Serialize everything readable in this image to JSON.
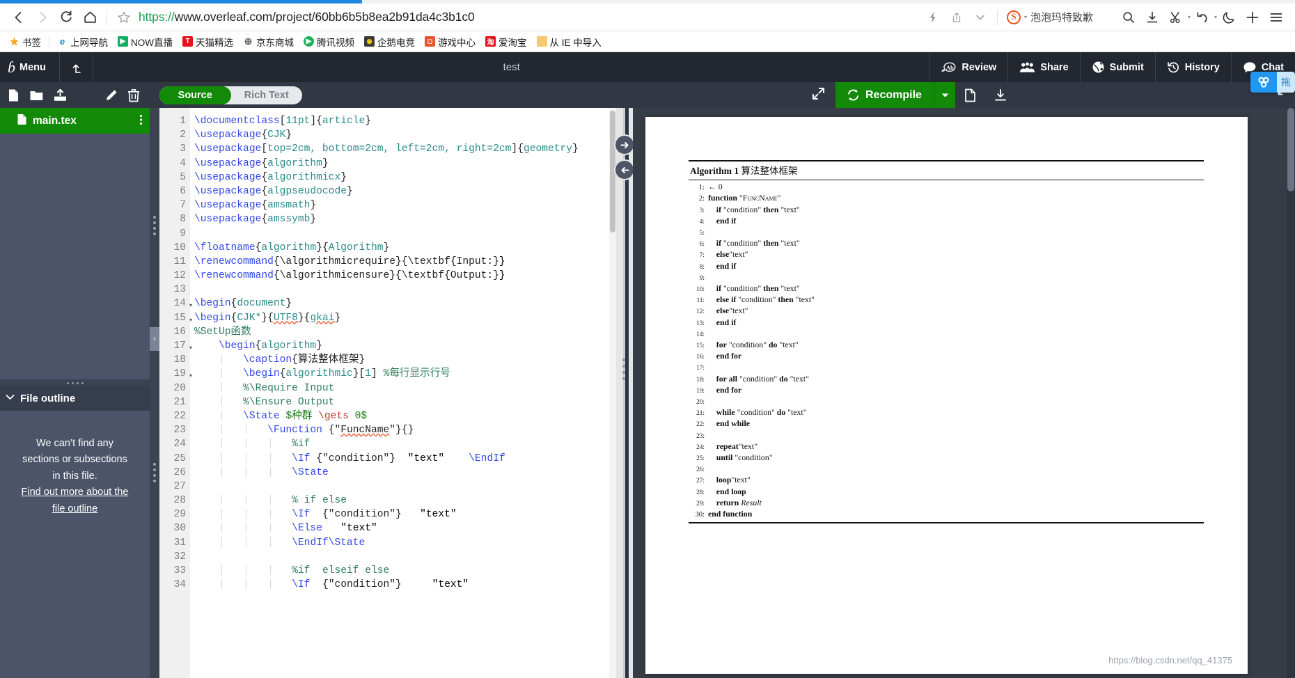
{
  "browser": {
    "url_scheme": "https://",
    "url_rest": "www.overleaf.com/project/60bb6b5b8ea2b91da4c3b1c0",
    "back_icon": "back-arrow-icon",
    "forward_icon": "forward-arrow-icon",
    "reload_icon": "reload-icon",
    "home_icon": "home-icon",
    "star_icon": "star-outline-icon",
    "lightning_icon": "lightning-icon",
    "share_icon": "share-icon",
    "chevron_icon": "chevron-down-icon",
    "profile_badge": "S",
    "profile_name": "泡泡玛特致歉",
    "search_icon": "search-icon",
    "download_icon": "download-icon",
    "scissors_icon": "scissors-icon",
    "undo_icon": "undo-icon",
    "moon_icon": "moon-icon",
    "plus_icon": "plus-icon",
    "menu_icon": "hamburger-menu-icon",
    "bookmarks": [
      {
        "label": "书签",
        "color": "#ffffff",
        "glyph": "★",
        "fg": "#f5a623"
      },
      {
        "label": "上网导航",
        "color": "#1a8cd8",
        "glyph": "e",
        "fg": "#ffffff"
      },
      {
        "label": "NOW直播",
        "color": "#0fae63",
        "glyph": "▶",
        "fg": "#ffffff"
      },
      {
        "label": "天猫精选",
        "color": "#e8131a",
        "glyph": "T",
        "fg": "#ffffff"
      },
      {
        "label": "京东商城",
        "color": "#ffffff",
        "glyph": "⊕",
        "fg": "#555555"
      },
      {
        "label": "腾讯视频",
        "color": "#1ab35a",
        "glyph": "▶",
        "fg": "#ffffff"
      },
      {
        "label": "企鹅电竞",
        "color": "#3b3b3b",
        "glyph": "🐧",
        "fg": "#ffd400"
      },
      {
        "label": "游戏中心",
        "color": "#e8542f",
        "glyph": "🎮",
        "fg": "#ffffff"
      },
      {
        "label": "爱淘宝",
        "color": "#e8131a",
        "glyph": "淘",
        "fg": "#ffffff"
      },
      {
        "label": "从 IE 中导入",
        "color": "#f7c873",
        "glyph": "",
        "fg": "#8a6d20"
      }
    ]
  },
  "overleaf_header": {
    "logo_glyph": "ɓ",
    "menu_label": "Menu",
    "back_icon": "up-left-arrow-icon",
    "project_title": "test",
    "buttons": [
      {
        "label": "Review",
        "icon": "review-ab-icon"
      },
      {
        "label": "Share",
        "icon": "people-icon"
      },
      {
        "label": "Submit",
        "icon": "globe-icon"
      },
      {
        "label": "History",
        "icon": "history-clock-icon"
      },
      {
        "label": "Chat",
        "icon": "chat-bubble-icon"
      }
    ],
    "floating_widget": {
      "icon": "sogou-logo-icon",
      "label": "拖"
    }
  },
  "editor_toolbar": {
    "new_file_icon": "new-file-icon",
    "new_folder_icon": "new-folder-icon",
    "upload_icon": "upload-icon",
    "rename_icon": "pencil-icon",
    "delete_icon": "trash-icon",
    "mode_source": "Source",
    "mode_rich_text": "Rich Text",
    "expand_icon": "expand-diagonal-icon",
    "recompile_label": "Recompile",
    "recompile_icon": "refresh-icon",
    "recompile_caret": "caret-down-icon",
    "pdf_icon": "pdf-file-icon",
    "download_pdf_icon": "download-pdf-icon",
    "fullscreen_icon": "fullscreen-corner-icon"
  },
  "sidebar": {
    "files": [
      {
        "name": "main.tex",
        "icon": "tex-file-icon",
        "menu": "kebab-menu-icon",
        "selected": true
      }
    ],
    "outline": {
      "chevron": "chevron-down-icon",
      "title": "File outline",
      "empty_line1": "We can’t find any",
      "empty_line2": "sections or subsections",
      "empty_line3": "in this file.",
      "link_line1": "Find out more about the",
      "link_line2": "file outline"
    }
  },
  "code": {
    "first_visible_line": 1,
    "lines": [
      {
        "n": 1,
        "fold": false,
        "text": "\\documentclass[11pt]{article}"
      },
      {
        "n": 2,
        "fold": false,
        "text": "\\usepackage{CJK}"
      },
      {
        "n": 3,
        "fold": false,
        "text": "\\usepackage[top=2cm, bottom=2cm, left=2cm, right=2cm]{geometry}"
      },
      {
        "n": 4,
        "fold": false,
        "text": "\\usepackage{algorithm}"
      },
      {
        "n": 5,
        "fold": false,
        "text": "\\usepackage{algorithmicx}"
      },
      {
        "n": 6,
        "fold": false,
        "text": "\\usepackage{algpseudocode}"
      },
      {
        "n": 7,
        "fold": false,
        "text": "\\usepackage{amsmath}"
      },
      {
        "n": 8,
        "fold": false,
        "text": "\\usepackage{amssymb}"
      },
      {
        "n": 9,
        "fold": false,
        "text": ""
      },
      {
        "n": 10,
        "fold": false,
        "text": "\\floatname{algorithm}{Algorithm}"
      },
      {
        "n": 11,
        "fold": false,
        "text": "\\renewcommand{\\algorithmicrequire}{\\textbf{Input:}}"
      },
      {
        "n": 12,
        "fold": false,
        "text": "\\renewcommand{\\algorithmicensure}{\\textbf{Output:}}"
      },
      {
        "n": 13,
        "fold": false,
        "text": ""
      },
      {
        "n": 14,
        "fold": true,
        "text": "\\begin{document}"
      },
      {
        "n": 15,
        "fold": true,
        "text": "\\begin{CJK*}{UTF8}{gkai}"
      },
      {
        "n": 16,
        "fold": false,
        "text": "%SetUp函数"
      },
      {
        "n": 17,
        "fold": true,
        "text": "    \\begin{algorithm}"
      },
      {
        "n": 18,
        "fold": false,
        "text": "        \\caption{算法整体框架}"
      },
      {
        "n": 19,
        "fold": true,
        "text": "        \\begin{algorithmic}[1] %每行显示行号"
      },
      {
        "n": 20,
        "fold": false,
        "text": "        %\\Require Input"
      },
      {
        "n": 21,
        "fold": false,
        "text": "        %\\Ensure Output"
      },
      {
        "n": 22,
        "fold": false,
        "text": "        \\State $种群 \\gets 0$"
      },
      {
        "n": 23,
        "fold": false,
        "text": "            \\Function {\"FuncName\"}{}"
      },
      {
        "n": 24,
        "fold": false,
        "text": "                %if"
      },
      {
        "n": 25,
        "fold": false,
        "text": "                \\If {\"condition\"}  \"text\"    \\EndIf"
      },
      {
        "n": 26,
        "fold": false,
        "text": "                \\State"
      },
      {
        "n": 27,
        "fold": false,
        "text": ""
      },
      {
        "n": 28,
        "fold": false,
        "text": "                % if else"
      },
      {
        "n": 29,
        "fold": false,
        "text": "                \\If  {\"condition\"}   \"text\""
      },
      {
        "n": 30,
        "fold": false,
        "text": "                \\Else   \"text\""
      },
      {
        "n": 31,
        "fold": false,
        "text": "                \\EndIf\\State"
      },
      {
        "n": 32,
        "fold": false,
        "text": ""
      },
      {
        "n": 33,
        "fold": false,
        "text": "                %if  elseif else"
      },
      {
        "n": 34,
        "fold": false,
        "text": "                \\If  {\"condition\"}     \"text\""
      }
    ]
  },
  "pdf": {
    "algorithm_label": "Algorithm 1",
    "algorithm_caption": "算法整体框架",
    "watermark": "https://blog.csdn.net/qq_41375",
    "lines": [
      {
        "n": "1:",
        "indent": 0,
        "html": "← 0"
      },
      {
        "n": "2:",
        "indent": 0,
        "html": "<b>function</b> \"F<span class=\"sc\">uncName</span>\""
      },
      {
        "n": "3:",
        "indent": 1,
        "html": "<b>if</b> \"condition\" <b>then</b> \"text\""
      },
      {
        "n": "4:",
        "indent": 1,
        "html": "<b>end if</b>"
      },
      {
        "n": "5:",
        "indent": 1,
        "html": ""
      },
      {
        "n": "6:",
        "indent": 1,
        "html": "<b>if</b> \"condition\" <b>then</b> \"text\""
      },
      {
        "n": "7:",
        "indent": 1,
        "html": "<b>else</b>\"text\""
      },
      {
        "n": "8:",
        "indent": 1,
        "html": "<b>end if</b>"
      },
      {
        "n": "9:",
        "indent": 1,
        "html": ""
      },
      {
        "n": "10:",
        "indent": 1,
        "html": "<b>if</b> \"condition\" <b>then</b> \"text\""
      },
      {
        "n": "11:",
        "indent": 1,
        "html": "<b>else if</b> \"condition\" <b>then</b> \"text\""
      },
      {
        "n": "12:",
        "indent": 1,
        "html": "<b>else</b>\"text\""
      },
      {
        "n": "13:",
        "indent": 1,
        "html": "<b>end if</b>"
      },
      {
        "n": "14:",
        "indent": 1,
        "html": ""
      },
      {
        "n": "15:",
        "indent": 1,
        "html": "<b>for</b> \"condition\" <b>do</b> \"text\""
      },
      {
        "n": "16:",
        "indent": 1,
        "html": "<b>end for</b>"
      },
      {
        "n": "17:",
        "indent": 1,
        "html": ""
      },
      {
        "n": "18:",
        "indent": 1,
        "html": "<b>for all</b> \"condition\" <b>do</b> \"text\""
      },
      {
        "n": "19:",
        "indent": 1,
        "html": "<b>end for</b>"
      },
      {
        "n": "20:",
        "indent": 1,
        "html": ""
      },
      {
        "n": "21:",
        "indent": 1,
        "html": "<b>while</b> \"condition\" <b>do</b> \"text\""
      },
      {
        "n": "22:",
        "indent": 1,
        "html": "<b>end while</b>"
      },
      {
        "n": "23:",
        "indent": 1,
        "html": ""
      },
      {
        "n": "24:",
        "indent": 1,
        "html": "<b>repeat</b>\"text\""
      },
      {
        "n": "25:",
        "indent": 1,
        "html": "<b>until</b> \"condition\""
      },
      {
        "n": "26:",
        "indent": 1,
        "html": ""
      },
      {
        "n": "27:",
        "indent": 1,
        "html": "<b>loop</b>\"text\""
      },
      {
        "n": "28:",
        "indent": 1,
        "html": "<b>end loop</b>"
      },
      {
        "n": "29:",
        "indent": 1,
        "html": "<b>return</b> <i>Result</i>"
      },
      {
        "n": "30:",
        "indent": 0,
        "html": "<b>end function</b>"
      }
    ]
  },
  "colors": {
    "overleaf_green": "#138a07",
    "header_dark": "#222730",
    "toolbar_dark": "#313843",
    "sidebar_slate": "#4b5468",
    "pdf_bg": "#373d47",
    "accent_blue": "#2196f3",
    "url_green": "#1aa053"
  }
}
